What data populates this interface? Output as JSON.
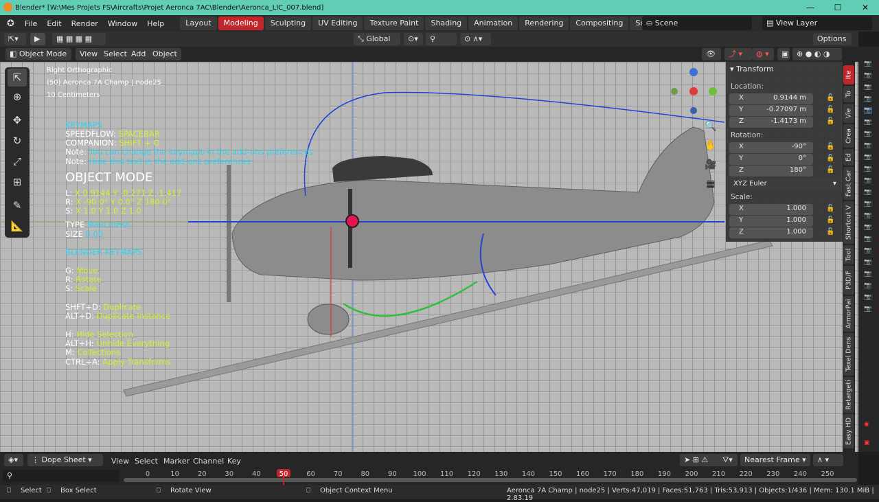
{
  "window": {
    "title": "Blender* [W:\\Mes Projets FS\\Aircrafts\\Projet Aeronca 7AC\\Blender\\Aeronca_LIC_007.blend]",
    "minimize": "—",
    "maximize": "☐",
    "close": "✕"
  },
  "menus": [
    "File",
    "Edit",
    "Render",
    "Window",
    "Help"
  ],
  "workspaces": [
    "Layout",
    "Modeling",
    "Sculpting",
    "UV Editing",
    "Texture Paint",
    "Shading",
    "Animation",
    "Rendering",
    "Compositing",
    "Scripting"
  ],
  "active_workspace": "Modeling",
  "add_tab": "+",
  "scene": "Scene",
  "view_layer": "View Layer",
  "transform_orientation": "Global",
  "options": "Options",
  "mode": "Object Mode",
  "vp_menus": [
    "View",
    "Select",
    "Add",
    "Object"
  ],
  "overlay": {
    "view": "Right Orthographic",
    "object": "(50) Aeronca 7A Champ | node25",
    "scale": "10 Centimeters"
  },
  "speedflow": {
    "keymaps": "KEYMAPS",
    "speedflow_k": "SPEEDFLOW:",
    "speedflow_v": "SPACEBAR",
    "companion_k": "COMPANION:",
    "companion_v": "SHIFT + Q",
    "note1_k": "Note:",
    "note1_v": "You can change the keymaps in the add-ons preferences",
    "note2_k": "Note:",
    "note2_v": "Hide this text in the add-ons preferences",
    "mode_title": "OBJECT MODE",
    "l_k": "L:",
    "l_v": "X 0.9144  Y -0.271  Z -1.417",
    "r_k": "R:",
    "r_v": "X -90.0°  Y 0.0°  Z 180.0°",
    "s_k": "S:",
    "s_v": "X 1.0  Y 1.0  Z 1.0",
    "type_k": "TYPE",
    "type_v": "Main mesh",
    "size_k": "SIZE",
    "size_v": "0.00",
    "blender_keymaps": "BLENDER KEYMAPS",
    "g_k": "G:",
    "g_v": "Move",
    "r2_k": "R:",
    "r2_v": "Rotate",
    "s2_k": "S:",
    "s2_v": "Scale",
    "shd_k": "SHFT+D:",
    "shd_v": "Duplicate",
    "altd_k": "ALT+D:",
    "altd_v": "Duplicate Instance",
    "h_k": "H:",
    "h_v": "Hide Selection",
    "alth_k": "ALT+H:",
    "alth_v": "Unhide Everything",
    "m_k": "M:",
    "m_v": "Collections",
    "ctrla_k": "CTRL+A:",
    "ctrla_v": "Apply Transforms"
  },
  "transform": {
    "title": "Transform",
    "location_label": "Location:",
    "location": [
      {
        "axis": "X",
        "value": "0.9144 m"
      },
      {
        "axis": "Y",
        "value": "-0.27097 m"
      },
      {
        "axis": "Z",
        "value": "-1.4173 m"
      }
    ],
    "rotation_label": "Rotation:",
    "rotation": [
      {
        "axis": "X",
        "value": "-90°"
      },
      {
        "axis": "Y",
        "value": "0°"
      },
      {
        "axis": "Z",
        "value": "180°"
      }
    ],
    "rotation_mode": "XYZ Euler",
    "scale_label": "Scale:",
    "scale": [
      {
        "axis": "X",
        "value": "1.000"
      },
      {
        "axis": "Y",
        "value": "1.000"
      },
      {
        "axis": "Z",
        "value": "1.000"
      }
    ]
  },
  "side_tabs": [
    "Ite",
    "To",
    "Vie",
    "Crea",
    "Ed",
    "Fast Car",
    "Shortcut V",
    "Tool",
    "P3D/F",
    "ArmorPai",
    "Texel Dens",
    "Retargeti",
    "Easy HD"
  ],
  "dope": {
    "editor": "Dope Sheet",
    "menus": [
      "View",
      "Select",
      "Marker",
      "Channel",
      "Key"
    ],
    "snap": "Nearest Frame"
  },
  "timeline": {
    "current": "50",
    "ticks": [
      "0",
      "10",
      "20",
      "30",
      "40",
      "50",
      "60",
      "70",
      "80",
      "90",
      "100",
      "110",
      "120",
      "130",
      "140",
      "150",
      "160",
      "170",
      "180",
      "190",
      "200",
      "210",
      "220",
      "230",
      "240",
      "250"
    ]
  },
  "status": {
    "select": "Select",
    "box_select": "Box Select",
    "rotate_view": "Rotate View",
    "context_menu": "Object Context Menu",
    "stats": "Aeronca 7A Champ | node25 | Verts:47,019 | Faces:51,763 | Tris:53,913 | Objects:1/436 | Mem: 130.1 MiB | 2.83.19"
  },
  "colors": {
    "accent": "#c0272d",
    "titlebar": "#60cdb4",
    "yellow_text": "#d5ef2b",
    "cyan_text": "#2bd5f2"
  }
}
